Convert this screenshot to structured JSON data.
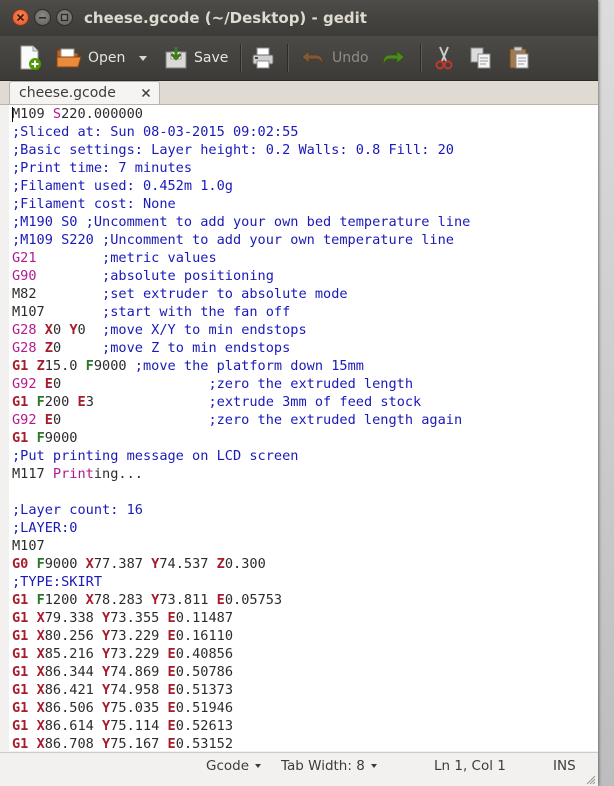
{
  "window": {
    "title": "cheese.gcode (~/Desktop) - gedit"
  },
  "toolbar": {
    "open_label": "Open",
    "save_label": "Save",
    "undo_label": "Undo"
  },
  "tabs": [
    {
      "label": "cheese.gcode"
    }
  ],
  "editor": {
    "lines": [
      [
        [
          "M109 ",
          ""
        ],
        [
          "S",
          "p"
        ],
        [
          "220.000000",
          ""
        ]
      ],
      [
        [
          ";Sliced at: Sun 08-03-2015 09:02:55",
          "c"
        ]
      ],
      [
        [
          ";Basic settings: Layer height: 0.2 Walls: 0.8 Fill: 20",
          "c"
        ]
      ],
      [
        [
          ";Print time: 7 minutes",
          "c"
        ]
      ],
      [
        [
          ";Filament used: 0.452m 1.0g",
          "c"
        ]
      ],
      [
        [
          ";Filament cost: None",
          "c"
        ]
      ],
      [
        [
          ";M190 S0 ;Uncomment to add your own bed temperature line",
          "c"
        ]
      ],
      [
        [
          ";M109 S220 ;Uncomment to add your own temperature line",
          "c"
        ]
      ],
      [
        [
          "G21",
          "p"
        ],
        [
          "        ",
          ""
        ],
        [
          ";metric values",
          "c"
        ]
      ],
      [
        [
          "G90",
          "p"
        ],
        [
          "        ",
          ""
        ],
        [
          ";absolute positioning",
          "c"
        ]
      ],
      [
        [
          "M82",
          ""
        ],
        [
          "        ",
          ""
        ],
        [
          ";set extruder to absolute mode",
          "c"
        ]
      ],
      [
        [
          "M107",
          ""
        ],
        [
          "       ",
          ""
        ],
        [
          ";start with the fan off",
          "c"
        ]
      ],
      [
        [
          "G28",
          "p"
        ],
        [
          " ",
          ""
        ],
        [
          "X",
          "d"
        ],
        [
          "0 ",
          ""
        ],
        [
          "Y",
          "d"
        ],
        [
          "0  ",
          ""
        ],
        [
          ";move X/Y to min endstops",
          "c"
        ]
      ],
      [
        [
          "G28",
          "p"
        ],
        [
          " ",
          ""
        ],
        [
          "Z",
          "d"
        ],
        [
          "0     ",
          ""
        ],
        [
          ";move Z to min endstops",
          "c"
        ]
      ],
      [
        [
          "G1",
          "d"
        ],
        [
          " ",
          ""
        ],
        [
          "Z",
          "d"
        ],
        [
          "15.0 ",
          ""
        ],
        [
          "F",
          "g"
        ],
        [
          "9000 ",
          ""
        ],
        [
          ";move the platform down 15mm",
          "c"
        ]
      ],
      [
        [
          "G92",
          "p"
        ],
        [
          " ",
          ""
        ],
        [
          "E",
          "d"
        ],
        [
          "0                  ",
          ""
        ],
        [
          ";zero the extruded length",
          "c"
        ]
      ],
      [
        [
          "G1",
          "d"
        ],
        [
          " ",
          ""
        ],
        [
          "F",
          "g"
        ],
        [
          "200 ",
          ""
        ],
        [
          "E",
          "d"
        ],
        [
          "3              ",
          ""
        ],
        [
          ";extrude 3mm of feed stock",
          "c"
        ]
      ],
      [
        [
          "G92",
          "p"
        ],
        [
          " ",
          ""
        ],
        [
          "E",
          "d"
        ],
        [
          "0                  ",
          ""
        ],
        [
          ";zero the extruded length again",
          "c"
        ]
      ],
      [
        [
          "G1",
          "d"
        ],
        [
          " ",
          ""
        ],
        [
          "F",
          "g"
        ],
        [
          "9000",
          ""
        ]
      ],
      [
        [
          ";Put printing message on LCD screen",
          "c"
        ]
      ],
      [
        [
          "M117 ",
          ""
        ],
        [
          "Print",
          "p"
        ],
        [
          "ing...",
          ""
        ]
      ],
      [
        [
          "",
          ""
        ]
      ],
      [
        [
          ";Layer count: 16",
          "c"
        ]
      ],
      [
        [
          ";LAYER:0",
          "c"
        ]
      ],
      [
        [
          "M107",
          ""
        ]
      ],
      [
        [
          "G0",
          "d"
        ],
        [
          " ",
          ""
        ],
        [
          "F",
          "g"
        ],
        [
          "9000 ",
          ""
        ],
        [
          "X",
          "d"
        ],
        [
          "77.387 ",
          ""
        ],
        [
          "Y",
          "d"
        ],
        [
          "74.537 ",
          ""
        ],
        [
          "Z",
          "d"
        ],
        [
          "0.300",
          ""
        ]
      ],
      [
        [
          ";TYPE:SKIRT",
          "c"
        ]
      ],
      [
        [
          "G1",
          "d"
        ],
        [
          " ",
          ""
        ],
        [
          "F",
          "g"
        ],
        [
          "1200 ",
          ""
        ],
        [
          "X",
          "d"
        ],
        [
          "78.283 ",
          ""
        ],
        [
          "Y",
          "d"
        ],
        [
          "73.811 ",
          ""
        ],
        [
          "E",
          "d"
        ],
        [
          "0.05753",
          ""
        ]
      ],
      [
        [
          "G1",
          "d"
        ],
        [
          " ",
          ""
        ],
        [
          "X",
          "d"
        ],
        [
          "79.338 ",
          ""
        ],
        [
          "Y",
          "d"
        ],
        [
          "73.355 ",
          ""
        ],
        [
          "E",
          "d"
        ],
        [
          "0.11487",
          ""
        ]
      ],
      [
        [
          "G1",
          "d"
        ],
        [
          " ",
          ""
        ],
        [
          "X",
          "d"
        ],
        [
          "80.256 ",
          ""
        ],
        [
          "Y",
          "d"
        ],
        [
          "73.229 ",
          ""
        ],
        [
          "E",
          "d"
        ],
        [
          "0.16110",
          ""
        ]
      ],
      [
        [
          "G1",
          "d"
        ],
        [
          " ",
          ""
        ],
        [
          "X",
          "d"
        ],
        [
          "85.216 ",
          ""
        ],
        [
          "Y",
          "d"
        ],
        [
          "73.229 ",
          ""
        ],
        [
          "E",
          "d"
        ],
        [
          "0.40856",
          ""
        ]
      ],
      [
        [
          "G1",
          "d"
        ],
        [
          " ",
          ""
        ],
        [
          "X",
          "d"
        ],
        [
          "86.344 ",
          ""
        ],
        [
          "Y",
          "d"
        ],
        [
          "74.869 ",
          ""
        ],
        [
          "E",
          "d"
        ],
        [
          "0.50786",
          ""
        ]
      ],
      [
        [
          "G1",
          "d"
        ],
        [
          " ",
          ""
        ],
        [
          "X",
          "d"
        ],
        [
          "86.421 ",
          ""
        ],
        [
          "Y",
          "d"
        ],
        [
          "74.958 ",
          ""
        ],
        [
          "E",
          "d"
        ],
        [
          "0.51373",
          ""
        ]
      ],
      [
        [
          "G1",
          "d"
        ],
        [
          " ",
          ""
        ],
        [
          "X",
          "d"
        ],
        [
          "86.506 ",
          ""
        ],
        [
          "Y",
          "d"
        ],
        [
          "75.035 ",
          ""
        ],
        [
          "E",
          "d"
        ],
        [
          "0.51946",
          ""
        ]
      ],
      [
        [
          "G1",
          "d"
        ],
        [
          " ",
          ""
        ],
        [
          "X",
          "d"
        ],
        [
          "86.614 ",
          ""
        ],
        [
          "Y",
          "d"
        ],
        [
          "75.114 ",
          ""
        ],
        [
          "E",
          "d"
        ],
        [
          "0.52613",
          ""
        ]
      ],
      [
        [
          "G1",
          "d"
        ],
        [
          " ",
          ""
        ],
        [
          "X",
          "d"
        ],
        [
          "86.708 ",
          ""
        ],
        [
          "Y",
          "d"
        ],
        [
          "75.167 ",
          ""
        ],
        [
          "E",
          "d"
        ],
        [
          "0.53152",
          ""
        ]
      ]
    ]
  },
  "statusbar": {
    "language": "Gcode",
    "tab_width": "Tab Width: 8",
    "position": "Ln 1, Col 1",
    "mode": "INS"
  },
  "icons": {
    "new": "new-document-icon",
    "open": "folder-open-icon",
    "save": "save-icon",
    "print": "printer-icon",
    "undo": "undo-icon",
    "redo": "redo-icon",
    "cut": "scissors-icon",
    "copy": "copy-icon",
    "paste": "clipboard-icon"
  },
  "colors": {
    "comment": "#1a1ab8",
    "keyword": "#b5198e",
    "axis": "#a51d2d",
    "feed": "#2a7a2a",
    "titlebar": "#3c3b37",
    "close_button": "#e0552b"
  }
}
